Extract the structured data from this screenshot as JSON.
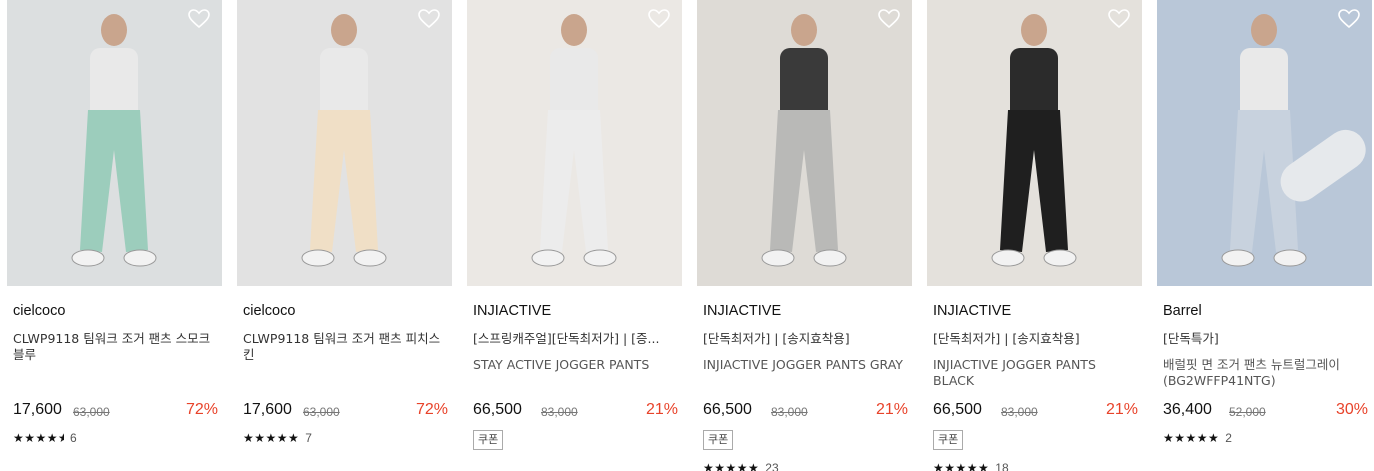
{
  "products": [
    {
      "brand": "cielcoco",
      "title": "CLWP9118 팀워크 조거 팬츠 스모크블루",
      "subtitle": "",
      "price": "17,600",
      "original_price": "63,000",
      "discount": "72%",
      "coupon": "",
      "stars": "★★★★",
      "half_star": true,
      "review_count": "6",
      "bg_color": "#dcdfe0",
      "garment_color": "#9ccdbc"
    },
    {
      "brand": "cielcoco",
      "title": "CLWP9118 팀워크 조거 팬츠 피치스킨",
      "subtitle": "",
      "price": "17,600",
      "original_price": "63,000",
      "discount": "72%",
      "coupon": "",
      "stars": "★★★★★",
      "half_star": false,
      "review_count": "7",
      "bg_color": "#e2e2e2",
      "garment_color": "#f0dfc6"
    },
    {
      "brand": "INJIACTIVE",
      "title": "[스프링캐주얼][단독최저가] | [증...",
      "subtitle": "STAY ACTIVE JOGGER PANTS",
      "price": "66,500",
      "original_price": "83,000",
      "discount": "21%",
      "coupon": "쿠폰",
      "stars": "",
      "half_star": false,
      "review_count": "",
      "bg_color": "#ebe8e4",
      "garment_color": "#ececec"
    },
    {
      "brand": "INJIACTIVE",
      "title": "[단독최저가] | [송지효착용]",
      "subtitle": "INJIACTIVE JOGGER PANTS GRAY",
      "price": "66,500",
      "original_price": "83,000",
      "discount": "21%",
      "coupon": "쿠폰",
      "stars": "★★★★★",
      "half_star": false,
      "review_count": "23",
      "bg_color": "#dedbd6",
      "garment_color": "#b9b9b7"
    },
    {
      "brand": "INJIACTIVE",
      "title": "[단독최저가] | [송지효착용]",
      "subtitle": "INJIACTIVE JOGGER PANTS BLACK",
      "price": "66,500",
      "original_price": "83,000",
      "discount": "21%",
      "coupon": "쿠폰",
      "stars": "★★★★★",
      "half_star": false,
      "review_count": "18",
      "bg_color": "#e4e1dc",
      "garment_color": "#1f1f1f"
    },
    {
      "brand": "Barrel",
      "title": "[단독특가]",
      "subtitle": "배럴핏 면 조거 팬츠 뉴트럴그레이(BG2WFFP41NTG)",
      "price": "36,400",
      "original_price": "52,000",
      "discount": "30%",
      "coupon": "",
      "stars": "★★★★★",
      "half_star": false,
      "review_count": "2",
      "bg_color": "#b9c7d8",
      "garment_color": "#c8d2de"
    }
  ]
}
